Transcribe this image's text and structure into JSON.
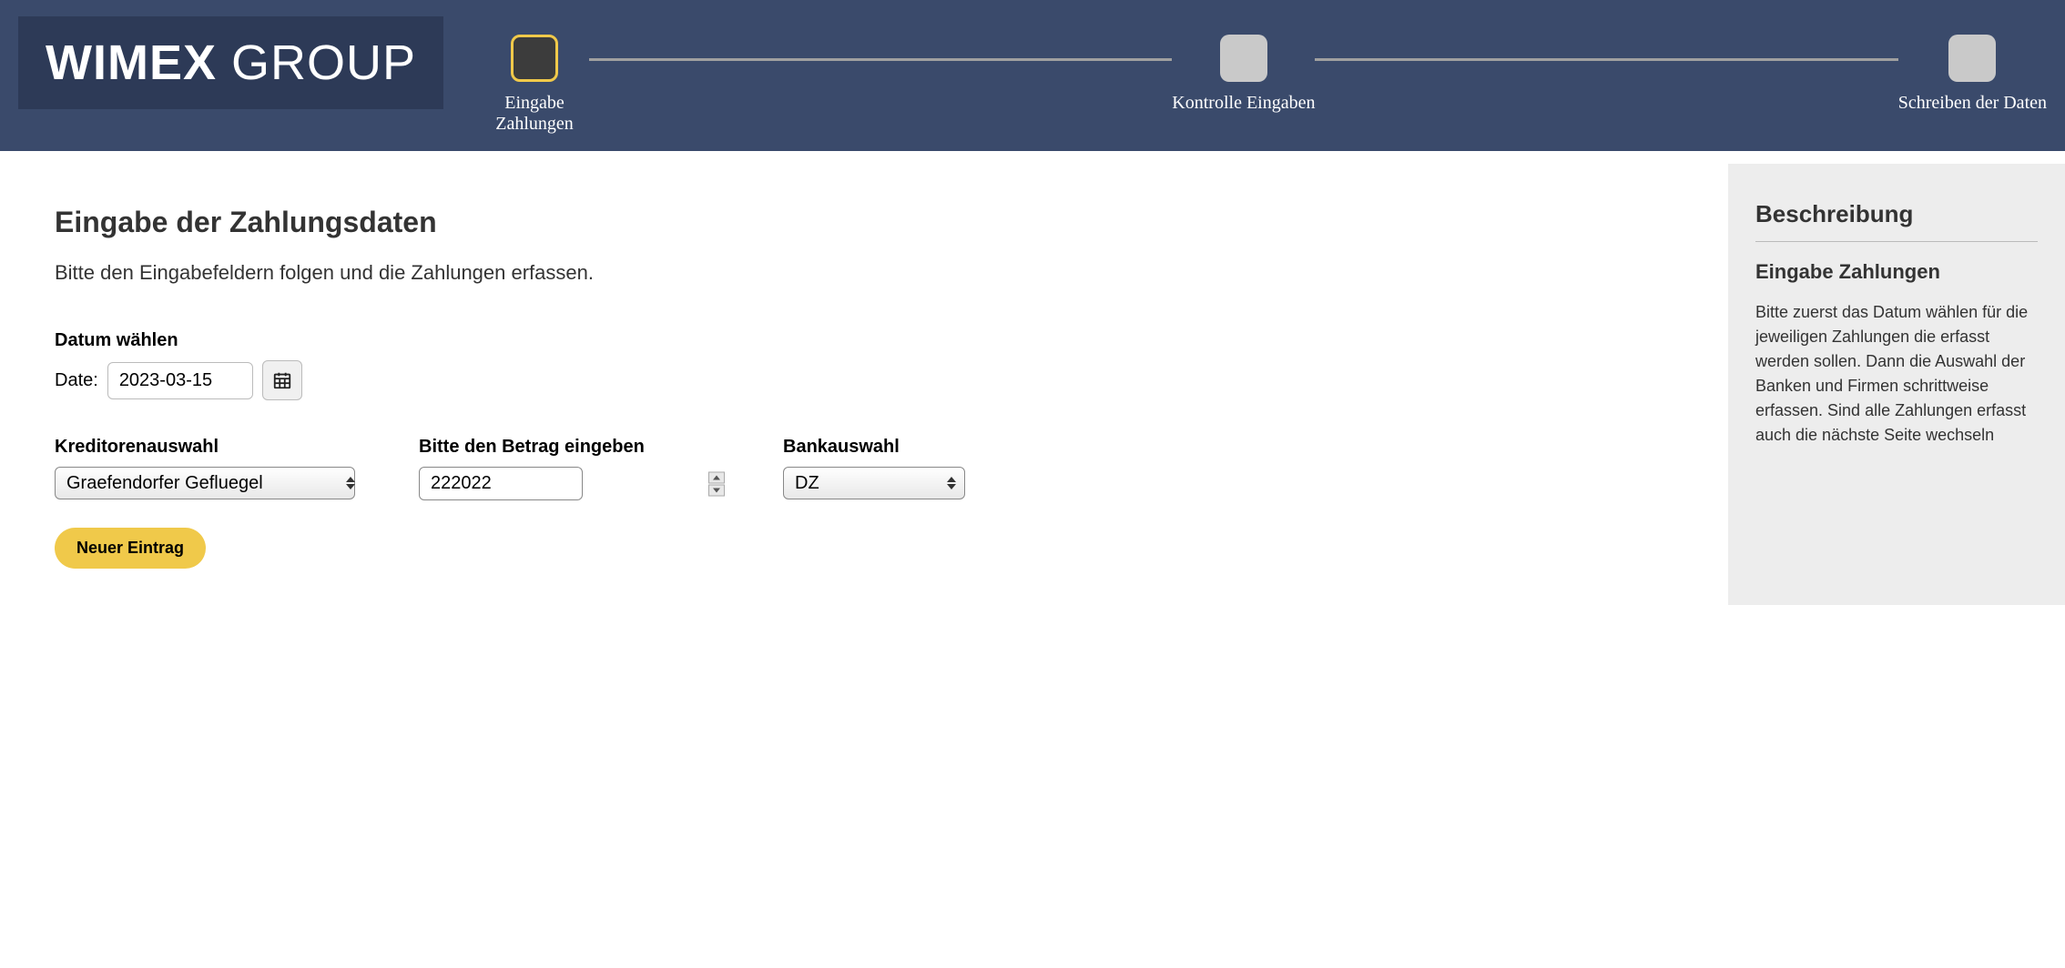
{
  "logo": {
    "bold": "WIMEX",
    "light": "GROUP"
  },
  "stepper": {
    "steps": [
      {
        "label": "Eingabe Zahlungen",
        "active": true
      },
      {
        "label": "Kontrolle Eingaben",
        "active": false
      },
      {
        "label": "Schreiben der Daten",
        "active": false
      }
    ]
  },
  "main": {
    "title": "Eingabe der Zahlungsdaten",
    "subtitle": "Bitte den Eingabefeldern folgen und die Zahlungen erfassen.",
    "date": {
      "label": "Datum wählen",
      "prefix": "Date:",
      "value": "2023-03-15"
    },
    "creditor": {
      "label": "Kreditorenauswahl",
      "selected": "Graefendorfer Gefluegel"
    },
    "amount": {
      "label": "Bitte den Betrag eingeben",
      "value": "222022"
    },
    "bank": {
      "label": "Bankauswahl",
      "selected": "DZ"
    },
    "newEntryButton": "Neuer Eintrag"
  },
  "sidebar": {
    "title": "Beschreibung",
    "subtitle": "Eingabe Zahlungen",
    "text": "Bitte zuerst das Datum wählen für die jeweiligen Zahlungen die erfasst werden sollen. Dann die Auswahl der Banken und Firmen schrittweise erfassen. Sind alle Zahlungen erfasst auch die nächste Seite wechseln"
  }
}
